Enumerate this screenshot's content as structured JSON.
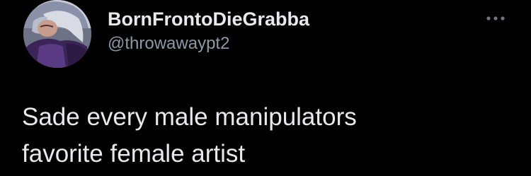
{
  "tweet": {
    "author": {
      "display_name": "BornFrontoDieGrabba",
      "handle": "@throwawaypt2",
      "avatar_icon": "character-avatar"
    },
    "text": "Sade every male manipulators\nfavorite female artist",
    "more_icon": "ellipsis-icon"
  },
  "colors": {
    "background": "#000000",
    "primary_text": "#e7e9ea",
    "secondary_text": "#8b98a5"
  }
}
